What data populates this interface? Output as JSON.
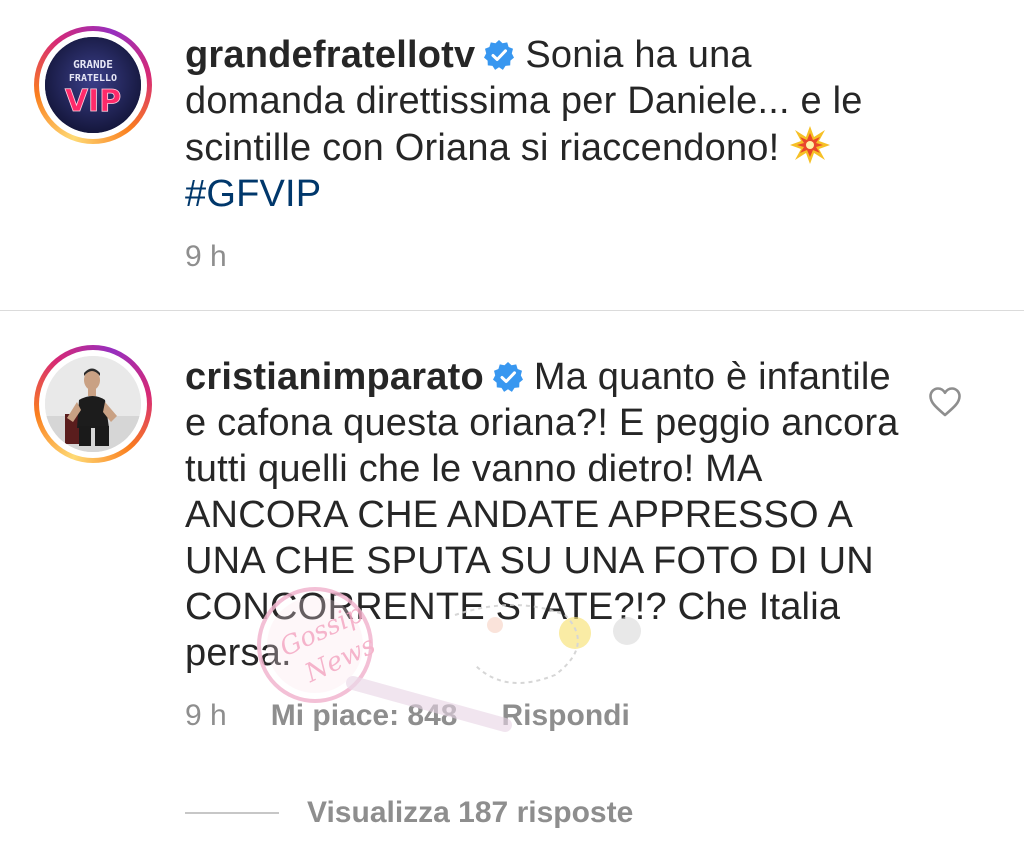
{
  "comments": [
    {
      "username": "grandefratellotv",
      "verified": true,
      "avatar": {
        "icon": "grande-fratello-vip-logo",
        "text_line1": "GRANDE",
        "text_line2": "FRATELLO",
        "text_line3": "VIP"
      },
      "text": "Sonia ha una domanda direttissima per Daniele... e le scintille con Oriana si riaccendono!",
      "emoji": "collision-emoji",
      "hashtag": "#GFVIP",
      "time": "9 h"
    },
    {
      "username": "cristianimparato",
      "verified": true,
      "avatar": {
        "icon": "profile-photo"
      },
      "text": "Ma quanto è infantile e cafona questa oriana?! E peggio ancora tutti quelli che le vanno dietro! MA ANCORA CHE ANDATE APPRESSO A UNA CHE SPUTA SU UNA FOTO DI UN CONCORRENTE STATE?!? Che Italia persa.",
      "time": "9 h",
      "likes_label": "Mi piace: 848",
      "reply_label": "Rispondi",
      "like_icon": "heart-outline-icon"
    }
  ],
  "view_replies_label": "Visualizza 187 risposte",
  "colors": {
    "text": "#262626",
    "muted": "#8e8e8e",
    "hashtag": "#00376b",
    "verified": "#3897f0",
    "divider": "#dbdbdb"
  }
}
